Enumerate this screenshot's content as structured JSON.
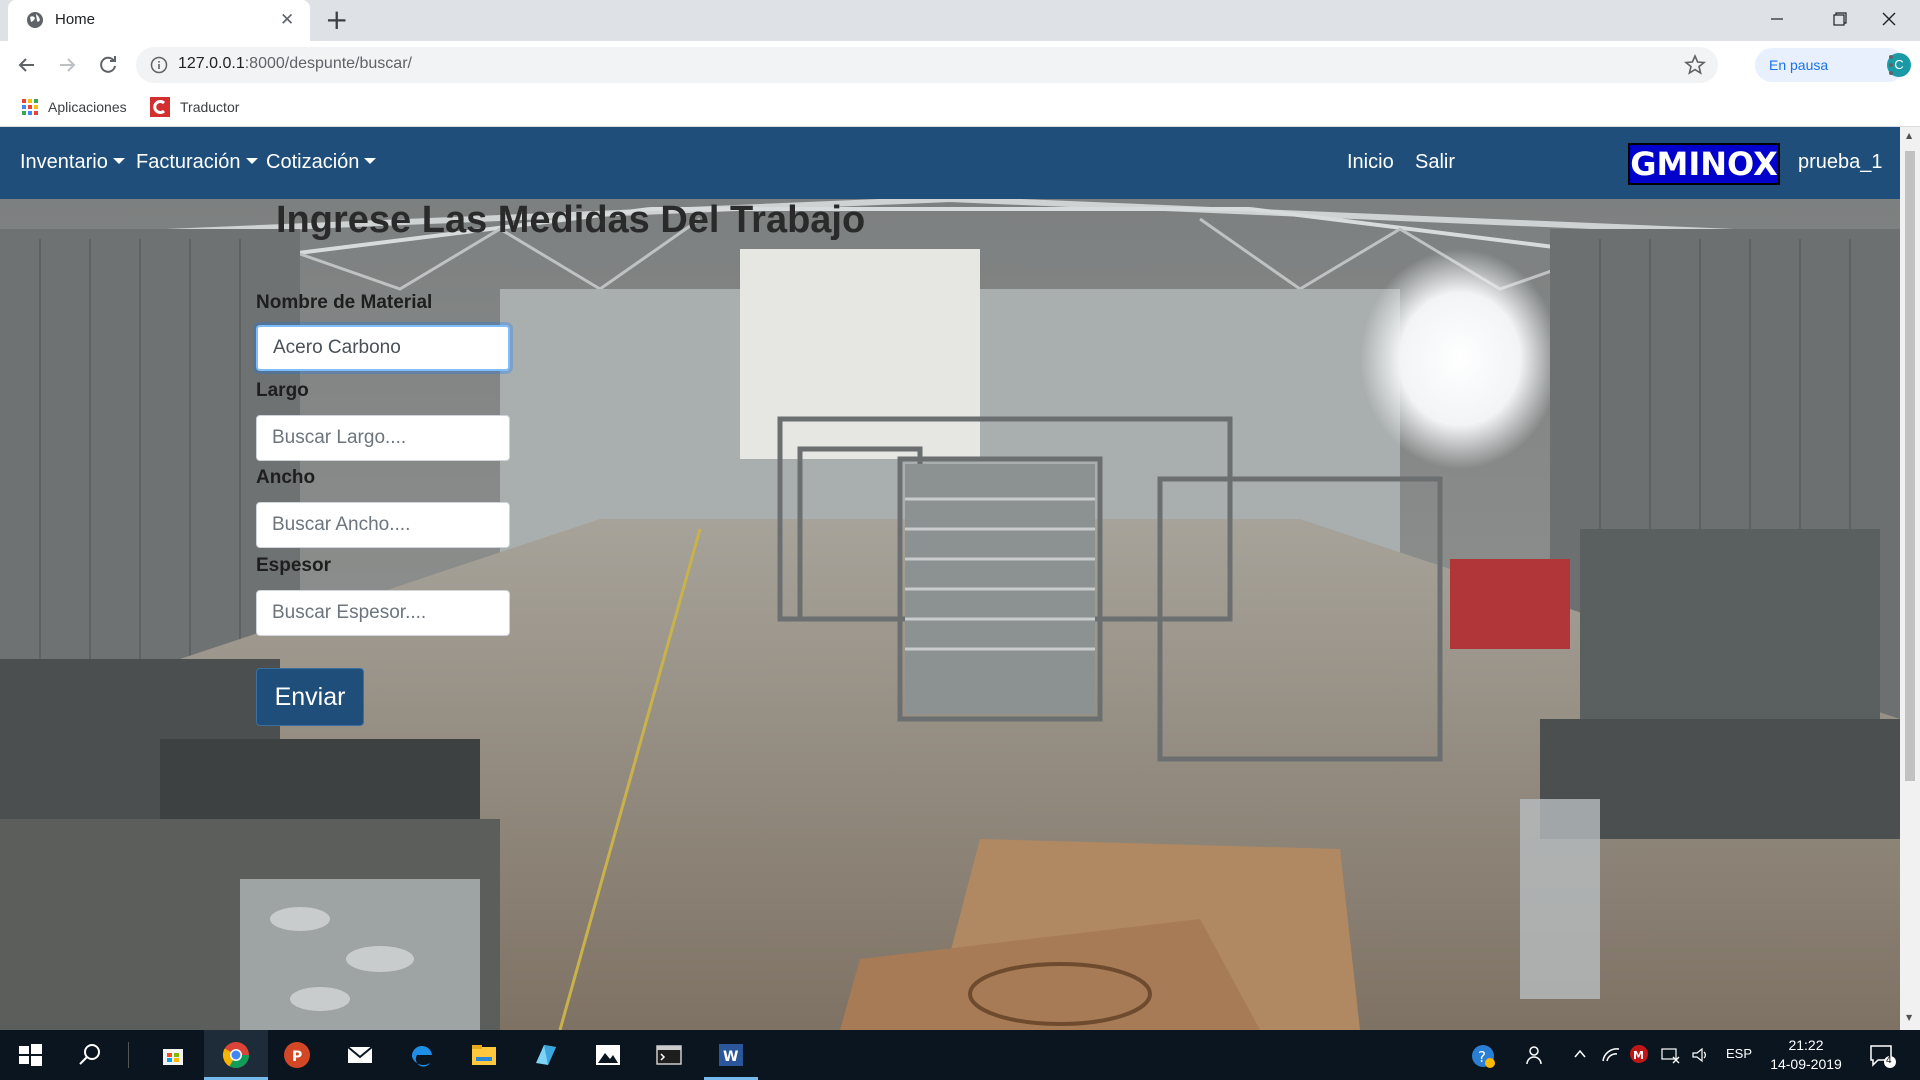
{
  "browser": {
    "tab_title": "Home",
    "tab_close": "✕",
    "new_tab": "+",
    "url_host": "127.0.0.1",
    "url_path": ":8000/despunte/buscar/",
    "profile_status": "En pausa",
    "profile_initial": "C",
    "bookmarks": [
      {
        "label": "Aplicaciones"
      },
      {
        "label": "Traductor"
      }
    ]
  },
  "navbar": {
    "menus": [
      {
        "label": "Inventario"
      },
      {
        "label": "Facturación"
      },
      {
        "label": "Cotización"
      }
    ],
    "links": [
      {
        "label": "Inicio"
      },
      {
        "label": "Salir"
      }
    ],
    "brand": "GMINOX",
    "username": "prueba_1",
    "color": "#1e4e79"
  },
  "form": {
    "title": "Ingrese Las Medidas Del Trabajo",
    "fields": [
      {
        "label": "Nombre de Material",
        "value": "Acero Carbono",
        "placeholder": ""
      },
      {
        "label": "Largo",
        "value": "",
        "placeholder": "Buscar Largo...."
      },
      {
        "label": "Ancho",
        "value": "",
        "placeholder": "Buscar Ancho...."
      },
      {
        "label": "Espesor",
        "value": "",
        "placeholder": "Buscar Espesor...."
      }
    ],
    "submit_label": "Enviar"
  },
  "taskbar": {
    "icons": [
      "windows-start-icon",
      "search-icon",
      "store-icon",
      "chrome-icon",
      "powerpoint-icon",
      "mail-icon",
      "edge-icon",
      "file-explorer-icon",
      "app-icon",
      "photos-icon",
      "terminal-icon",
      "word-icon"
    ],
    "language": "ESP",
    "time": "21:22",
    "date": "14-09-2019",
    "notification_count": "4"
  }
}
